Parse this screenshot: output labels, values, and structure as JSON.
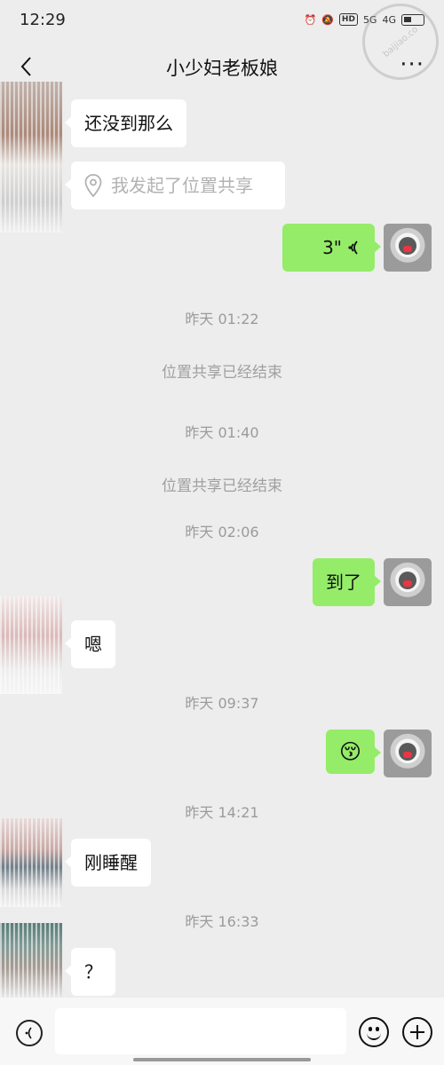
{
  "status_bar": {
    "time": "12:29",
    "hd_label": "HD",
    "net_5g": "5G",
    "net_4g": "4G",
    "watermark_text": "baijiao.co"
  },
  "header": {
    "title": "小少妇老板娘",
    "more": "···"
  },
  "messages": {
    "m1": "还没到那么",
    "m2_location": "我发起了位置共享",
    "m3_voice": "3\"",
    "m4_sys": "位置共享已经结束",
    "m5_sys": "位置共享已经结束",
    "m6": "到了",
    "m7": "嗯",
    "m8_emoji": "😚",
    "m9": "刚睡醒",
    "m10": "？"
  },
  "timestamps": {
    "t1": "昨天 01:22",
    "t2": "昨天 01:40",
    "t3": "昨天 02:06",
    "t4": "昨天 09:37",
    "t5": "昨天 14:21",
    "t6": "昨天 16:33"
  },
  "input": {
    "placeholder": ""
  },
  "colors": {
    "sent_bubble": "#95ec69",
    "received_bubble": "#ffffff",
    "background": "#ededed"
  }
}
